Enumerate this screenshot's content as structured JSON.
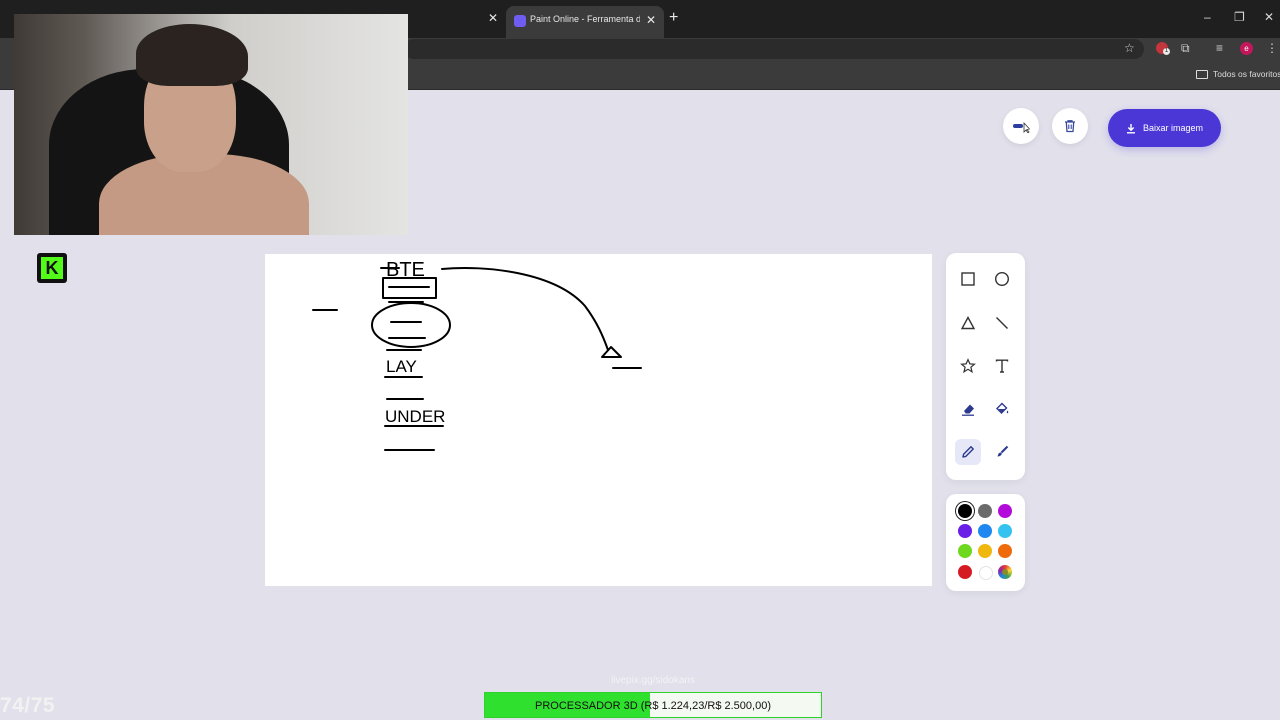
{
  "browser": {
    "tabs": [
      {
        "label": "",
        "active": false
      },
      {
        "label": "Paint Online - Ferramenta de D",
        "active": true
      }
    ],
    "bookmarks_bar": {
      "all_bookmarks_label": "Todos os favoritos"
    },
    "extension_badge": "1",
    "profile_initial": "e"
  },
  "stream": {
    "badge_letter": "K",
    "donation_link": "livepix.gg/sidokans",
    "goal": {
      "text": "PROCESSADOR 3D (R$ 1.224,23/R$ 2.500,00)",
      "current": 1224.23,
      "target": 2500.0
    },
    "counter": "74/75"
  },
  "app": {
    "download_label": "Baixar imagem",
    "buttons": {
      "stroke_size": "stroke-size-icon",
      "clear": "trash-icon"
    },
    "canvas": {
      "handwritten_text": [
        "BTE",
        "LAY",
        "UNDER"
      ]
    },
    "tools": [
      {
        "name": "rectangle",
        "icon": "square-icon",
        "active": false
      },
      {
        "name": "circle",
        "icon": "circle-icon",
        "active": false
      },
      {
        "name": "triangle",
        "icon": "triangle-icon",
        "active": false
      },
      {
        "name": "line",
        "icon": "line-icon",
        "active": false
      },
      {
        "name": "star",
        "icon": "star-icon",
        "active": false
      },
      {
        "name": "text",
        "icon": "text-icon",
        "active": false
      },
      {
        "name": "eraser",
        "icon": "eraser-icon",
        "active": false
      },
      {
        "name": "fill",
        "icon": "paint-bucket-icon",
        "active": false
      },
      {
        "name": "pencil",
        "icon": "pencil-icon",
        "active": true
      },
      {
        "name": "brush",
        "icon": "brush-icon",
        "active": false
      }
    ],
    "colors": [
      "#000000",
      "#6b6b6b",
      "#b20ad8",
      "#6a1fe8",
      "#1e88f0",
      "#34c3f0",
      "#6ed81e",
      "#f0b70e",
      "#ef6a0a",
      "#d41b24",
      "#ffffff",
      "custom"
    ],
    "selected_color": "#000000",
    "accent": "#4a37d6"
  }
}
